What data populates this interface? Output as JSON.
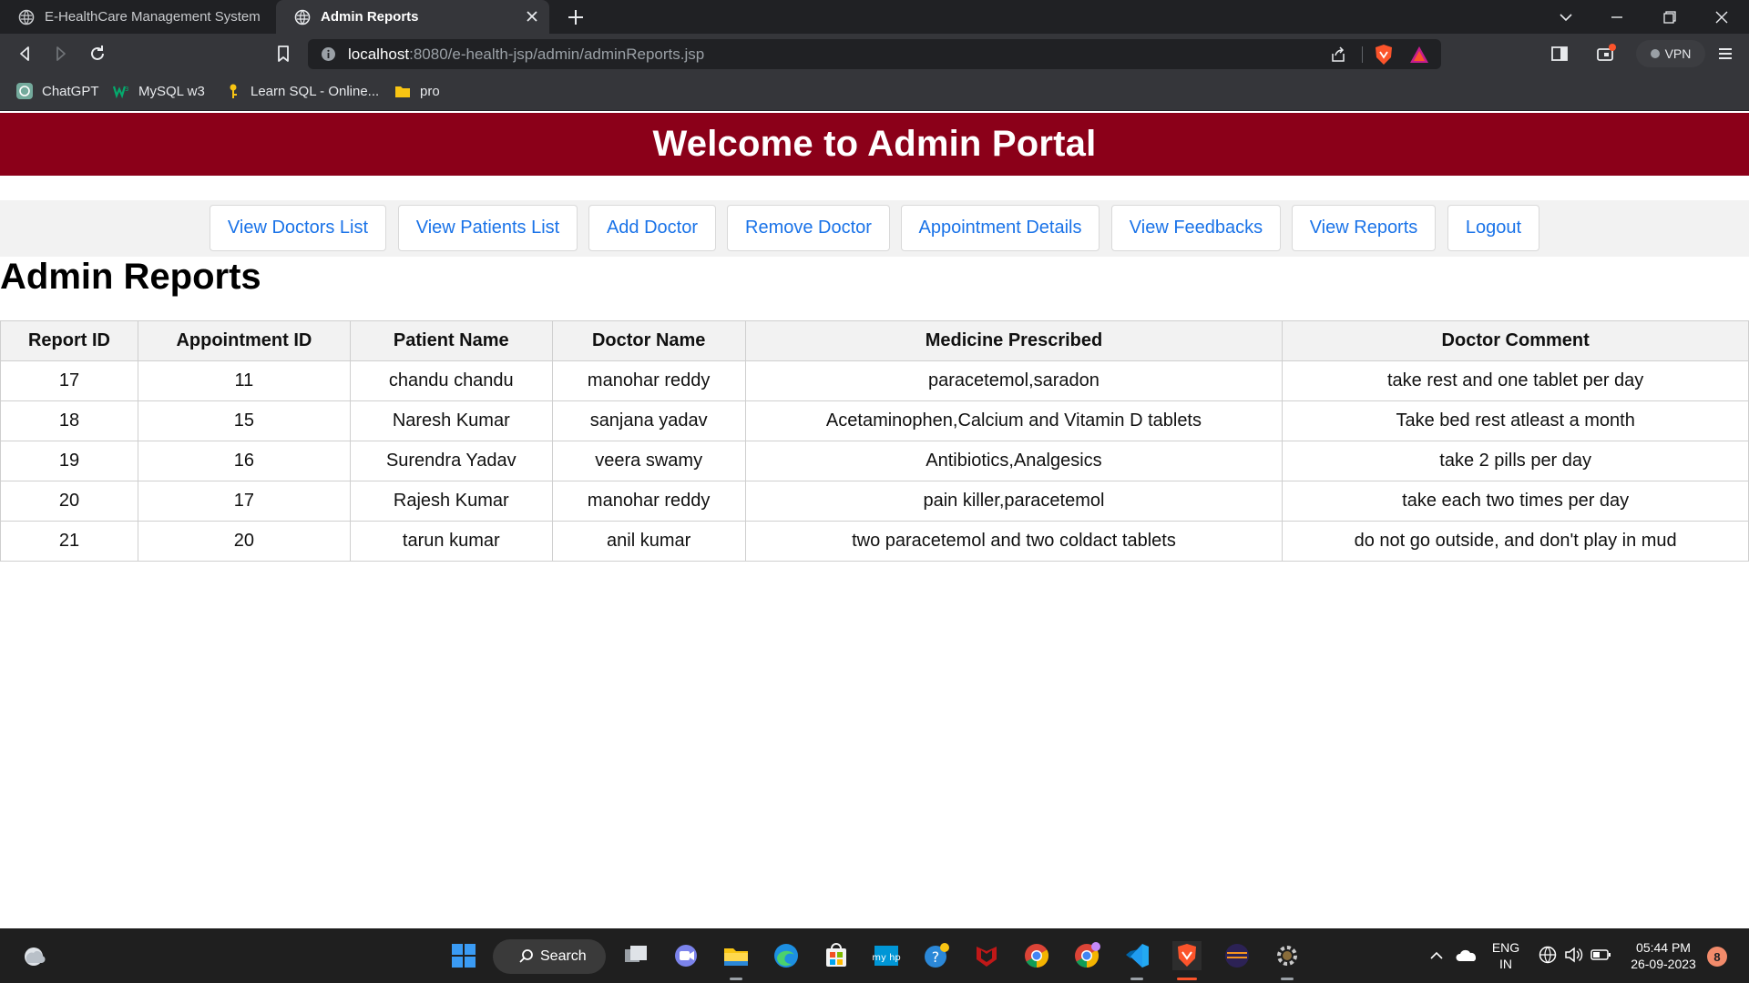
{
  "browser": {
    "tabs": [
      {
        "title": "E-HealthCare Management System"
      },
      {
        "title": "Admin Reports"
      }
    ],
    "url": {
      "host": "localhost",
      "path": ":8080/e-health-jsp/admin/adminReports.jsp"
    },
    "vpn_label": "VPN",
    "bookmarks": [
      {
        "label": "ChatGPT",
        "icon": "chatgpt-icon"
      },
      {
        "label": "MySQL w3",
        "icon": "w3schools-icon"
      },
      {
        "label": "Learn SQL - Online...",
        "icon": "key-icon"
      },
      {
        "label": "pro",
        "icon": "folder-icon"
      }
    ]
  },
  "page": {
    "banner_title": "Welcome to Admin Portal",
    "nav": [
      "View Doctors List",
      "View Patients List",
      "Add Doctor",
      "Remove Doctor",
      "Appointment Details",
      "View Feedbacks",
      "View Reports",
      "Logout"
    ],
    "title": "Admin Reports",
    "table": {
      "headers": [
        "Report ID",
        "Appointment ID",
        "Patient Name",
        "Doctor Name",
        "Medicine Prescribed",
        "Doctor Comment"
      ],
      "rows": [
        [
          "17",
          "11",
          "chandu chandu",
          "manohar reddy",
          "paracetemol,saradon",
          "take rest and one tablet per day"
        ],
        [
          "18",
          "15",
          "Naresh Kumar",
          "sanjana yadav",
          "Acetaminophen,Calcium and Vitamin D tablets",
          "Take bed rest atleast a month"
        ],
        [
          "19",
          "16",
          "Surendra Yadav",
          "veera swamy",
          "Antibiotics,Analgesics",
          "take 2 pills per day"
        ],
        [
          "20",
          "17",
          "Rajesh Kumar",
          "manohar reddy",
          "pain killer,paracetemol",
          "take each two times per day"
        ],
        [
          "21",
          "20",
          "tarun kumar",
          "anil kumar",
          "two paracetemol and two coldact tablets",
          "do not go outside, and don't play in mud"
        ]
      ]
    }
  },
  "taskbar": {
    "search_label": "Search",
    "lang_top": "ENG",
    "lang_bottom": "IN",
    "time": "05:44 PM",
    "date": "26-09-2023",
    "notifications": "8"
  },
  "colors": {
    "banner": "#8b0019",
    "link": "#1a73e8",
    "chrome_dark": "#202124",
    "chrome_mid": "#35363a"
  }
}
